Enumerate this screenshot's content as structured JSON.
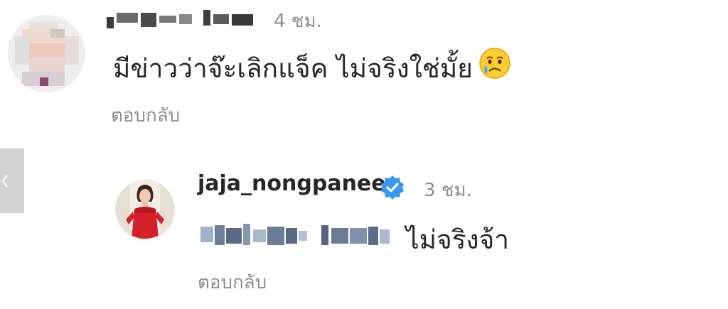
{
  "comment": {
    "time": "4 ชม.",
    "text": "มีข่าวว่าจ๊ะเลิกแจ็ค ไม่จริงใช่มั้ย",
    "reply_label": "ตอบกลับ",
    "avatar_icon": "blurred-avatar",
    "emoji_icon": "crying-face-emoji"
  },
  "reply": {
    "username": "jaja_nongpanee",
    "verified_icon": "verified-badge-icon",
    "time": "3 ชม.",
    "text": "ไม่จริงจ้า",
    "reply_label": "ตอบกลับ",
    "avatar_icon": "profile-photo-red-dress"
  },
  "side_handle": {
    "icon": "chevron-left-icon"
  },
  "colors": {
    "text": "#262626",
    "muted": "#8e8e8e",
    "verified": "#3897f0",
    "accent_red": "#d4202a"
  }
}
